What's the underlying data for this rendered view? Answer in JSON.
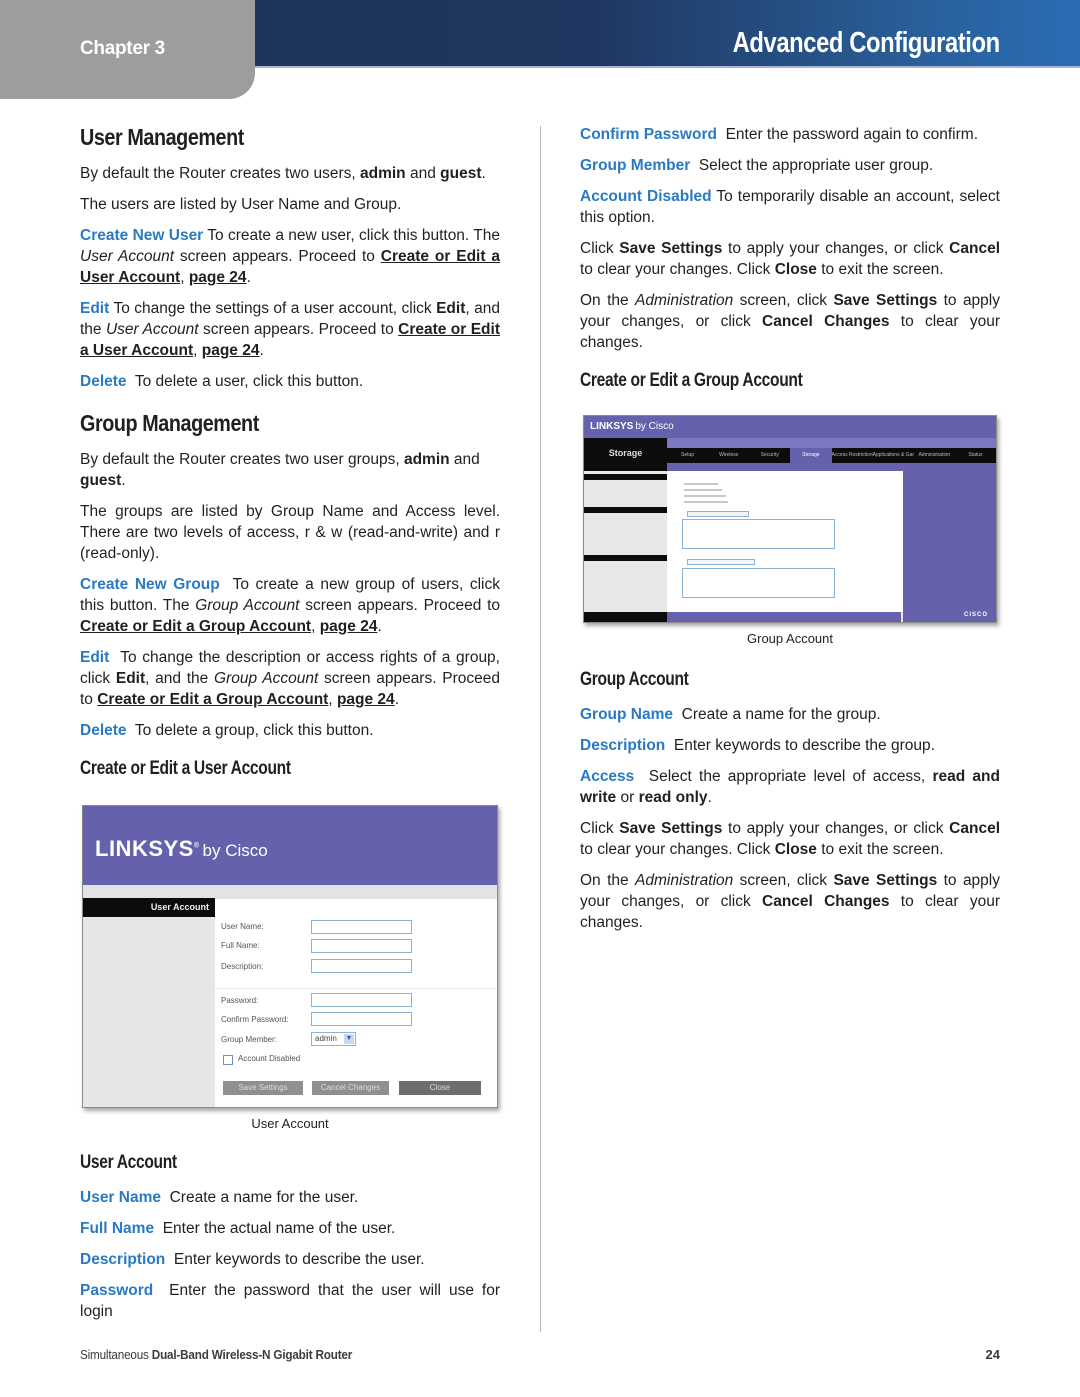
{
  "header": {
    "chapter": "Chapter 3",
    "title": "Advanced Configuration",
    "colors": {
      "bar_dark": "#1d3257",
      "bar_light": "#2a6db4",
      "chapter_tab": "#9c9d9f",
      "term_blue": "#2a7ac2"
    }
  },
  "left": {
    "user_mgmt": {
      "heading": "User Management",
      "p1": {
        "a": "By default the Router creates two users, ",
        "b1": "admin",
        "c": " and ",
        "b2": "guest",
        "d": "."
      },
      "p2": "The users are listed by User Name and Group.",
      "create": {
        "term": "Create New User",
        "a": " To create a new user, click this button. The ",
        "em": "User Account",
        "b": " screen appears. Proceed to ",
        "link": "Create or Edit a User Account",
        "sep": ", ",
        "page": "page 24",
        "end": "."
      },
      "edit": {
        "term": "Edit",
        "a": " To change the settings of a user account, click ",
        "bold": "Edit",
        "b": ", and the ",
        "em": "User Account",
        "c": " screen appears. Proceed to ",
        "link": "Create or Edit a User Account",
        "sep": ", ",
        "page": "page 24",
        "end": "."
      },
      "delete": {
        "term": "Delete",
        "text": "  To delete a user, click this button."
      }
    },
    "group_mgmt": {
      "heading": "Group Management",
      "p1": {
        "a": "By default the Router creates two user groups, ",
        "b1": "admin",
        "c": " and ",
        "b2": "guest",
        "d": "."
      },
      "p2": "The groups are listed by Group Name and Access level. There are two levels of access, r & w (read-and-write) and r (read-only).",
      "create": {
        "term": "Create New Group",
        "a": "  To create a new group of users, click this button. The ",
        "em": "Group Account",
        "b": " screen appears. Proceed to ",
        "link": "Create or Edit a Group Account",
        "sep": ", ",
        "page": "page 24",
        "end": "."
      },
      "edit": {
        "term": "Edit",
        "a": "  To change the description or access rights of a group, click ",
        "bold": "Edit",
        "b": ", and the ",
        "em": "Group Account",
        "c": " screen appears. Proceed to ",
        "link": "Create or Edit a Group Account",
        "sep": ", ",
        "page": "page 24",
        "end": "."
      },
      "delete": {
        "term": "Delete",
        "text": "  To delete a group, click this button."
      }
    },
    "create_user_heading": "Create or Edit a User Account",
    "user_figure": {
      "logo": "LINKSYS",
      "logo_suffix": "by Cisco",
      "section": "User Account",
      "fields": [
        "User Name:",
        "Full Name:",
        "Description:",
        "Password:",
        "Confirm Password:",
        "Group Member:"
      ],
      "group_member_value": "admin",
      "checkbox_label": "Account Disabled",
      "buttons": [
        "Save Settings",
        "Cancel Changes",
        "Close"
      ],
      "caption": "User Account"
    },
    "user_account": {
      "heading": "User Account",
      "items": [
        {
          "term": "User Name",
          "text": "  Create a name for the user."
        },
        {
          "term": "Full Name",
          "text": "  Enter the actual name of the user."
        },
        {
          "term": "Description",
          "text": "  Enter keywords to describe the user."
        },
        {
          "term": "Password",
          "text": "  Enter the password that the user will use for login"
        }
      ]
    }
  },
  "right": {
    "items": [
      {
        "term": "Confirm Password",
        "text": "  Enter the password again to confirm."
      },
      {
        "term": "Group Member",
        "text": "  Select the appropriate user group."
      },
      {
        "term": "Account Disabled",
        "text": " To temporarily disable an account, select this option."
      }
    ],
    "save1": {
      "a": "Click ",
      "b1": "Save Settings",
      "c": " to apply your changes, or click ",
      "b2": "Cancel",
      "d": " to clear your changes. Click ",
      "b3": "Close",
      "e": " to exit the screen."
    },
    "admin1": {
      "a": "On the ",
      "em": "Administration",
      "b": " screen, click ",
      "b1": "Save Settings",
      "c": " to apply your changes, or click ",
      "b2": "Cancel Changes",
      "d": " to clear your changes."
    },
    "create_group_heading": "Create or Edit a Group Account",
    "group_figure": {
      "logo": "LINKSYS",
      "logo_suffix": "by Cisco",
      "section": "Storage",
      "tabs": [
        "Setup",
        "Wireless",
        "Security",
        "Storage",
        "Access Restrictions",
        "Applications & Gaming",
        "Administration",
        "Status"
      ],
      "active_tab": "Storage",
      "brand": "CISCO",
      "caption": "Group Account"
    },
    "group_account": {
      "heading": "Group Account",
      "items": [
        {
          "term": "Group Name",
          "text": "  Create a name for the group."
        },
        {
          "term": "Description",
          "text": "  Enter keywords to describe the group."
        }
      ],
      "access": {
        "term": "Access",
        "a": "  Select the appropriate level of access, ",
        "b1": "read and write",
        "c": " or ",
        "b2": "read only",
        "d": "."
      }
    },
    "save2": {
      "a": "Click ",
      "b1": "Save Settings",
      "c": " to apply your changes, or click ",
      "b2": "Cancel",
      "d": " to clear your changes. Click ",
      "b3": "Close",
      "e": " to exit the screen."
    },
    "admin2": {
      "a": "On the ",
      "em": "Administration",
      "b": " screen, click ",
      "b1": "Save Settings",
      "c": " to apply your changes, or click ",
      "b2": "Cancel Changes",
      "d": " to clear your changes."
    }
  },
  "footer": {
    "product_pre": "Simultaneous ",
    "product_bold": "Dual-Band Wireless-N Gigabit Router",
    "page_number": "24"
  }
}
